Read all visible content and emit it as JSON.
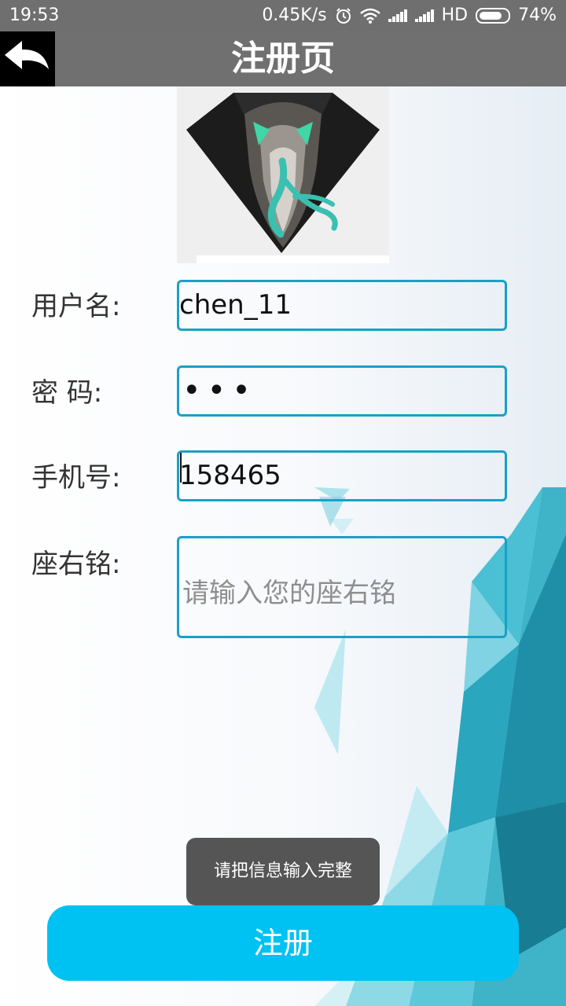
{
  "status_bar": {
    "time": "19:53",
    "network_speed": "0.45K/s",
    "network_type": "HD",
    "battery": "74%",
    "icons": [
      "alarm-icon",
      "wifi-icon",
      "signal-icon",
      "signal-icon",
      "battery-icon"
    ]
  },
  "header": {
    "title": "注册页",
    "back_icon": "back-arrow-icon"
  },
  "form": {
    "username": {
      "label": "用户名:",
      "value": "chen_11"
    },
    "password": {
      "label": "密 码:",
      "value": "•••"
    },
    "phone": {
      "label": "手机号:",
      "value": "158465"
    },
    "motto": {
      "label": "座右铭:",
      "placeholder": "请输入您的座右铭"
    }
  },
  "toast": {
    "message": "请把信息输入完整"
  },
  "register_button": {
    "label": "注册"
  },
  "colors": {
    "header_bg": "#707070",
    "field_border": "#1aa0c6",
    "button_bg": "#00c2f2",
    "toast_bg": "#555555"
  }
}
